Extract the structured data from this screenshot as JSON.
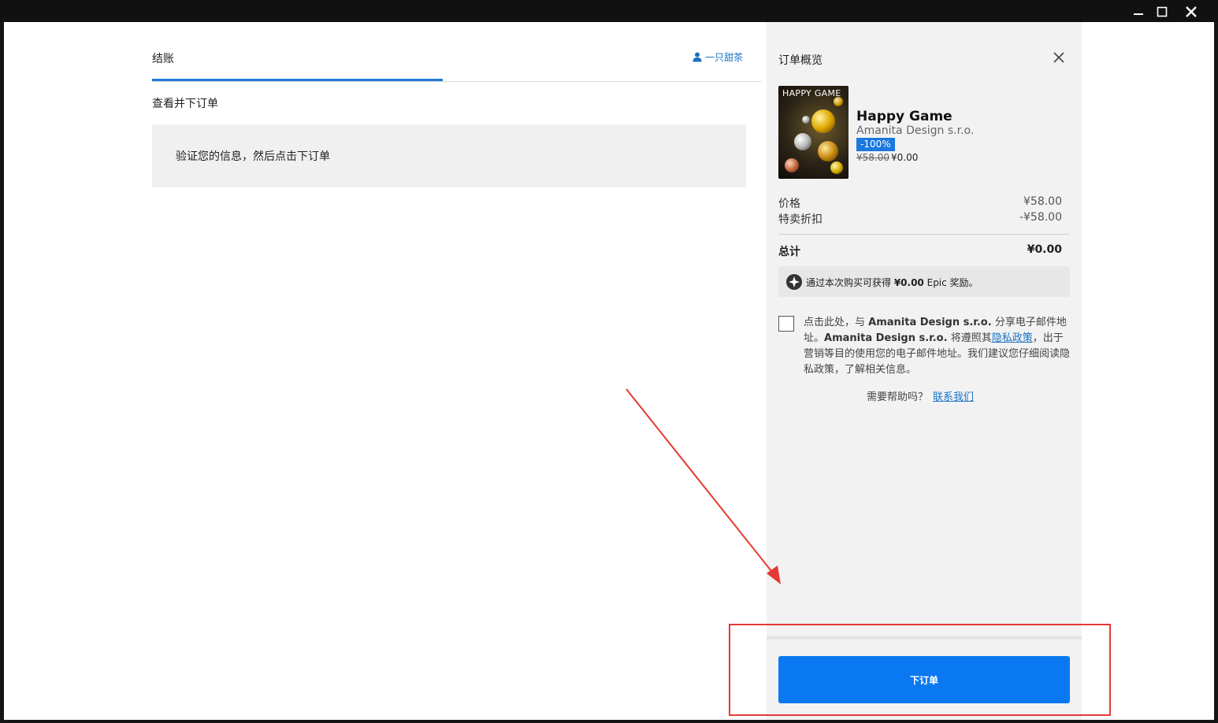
{
  "checkout": {
    "tab_label": "结账",
    "user_name": "一只甜茶",
    "section_title": "查看并下订单",
    "info_text": "验证您的信息，然后点击下订单"
  },
  "summary": {
    "title": "订单概览",
    "product": {
      "thumb_title": "HAPPY GAME",
      "name": "Happy Game",
      "publisher": "Amanita Design s.r.o.",
      "discount": "-100%",
      "original_price": "¥58.00",
      "final_price": "¥0.00"
    },
    "price_label": "价格",
    "price_value": "¥58.00",
    "discount_label": "特卖折扣",
    "discount_value": "-¥58.00",
    "total_label": "总计",
    "total_value": "¥0.00",
    "rewards": {
      "prefix": "通过本次购买可获得 ",
      "amount": "¥0.00",
      "suffix": " Epic 奖励。"
    },
    "consent": {
      "part1": "点击此处，与 ",
      "publisher1": "Amanita Design s.r.o.",
      "part2": " 分享电子邮件地址。",
      "publisher2": "Amanita Design s.r.o.",
      "part3": " 将遵照其",
      "privacy_link": "隐私政策",
      "part4": "，出于营销等目的使用您的电子邮件地址。我们建议您仔细阅读隐私政策，了解相关信息。"
    },
    "help_text": "需要帮助吗？",
    "contact_link": "联系我们",
    "place_order": "下订单"
  },
  "colors": {
    "accent": "#0a78f0",
    "tab_underline": "#1f7ad8",
    "annotation": "#e53935"
  }
}
